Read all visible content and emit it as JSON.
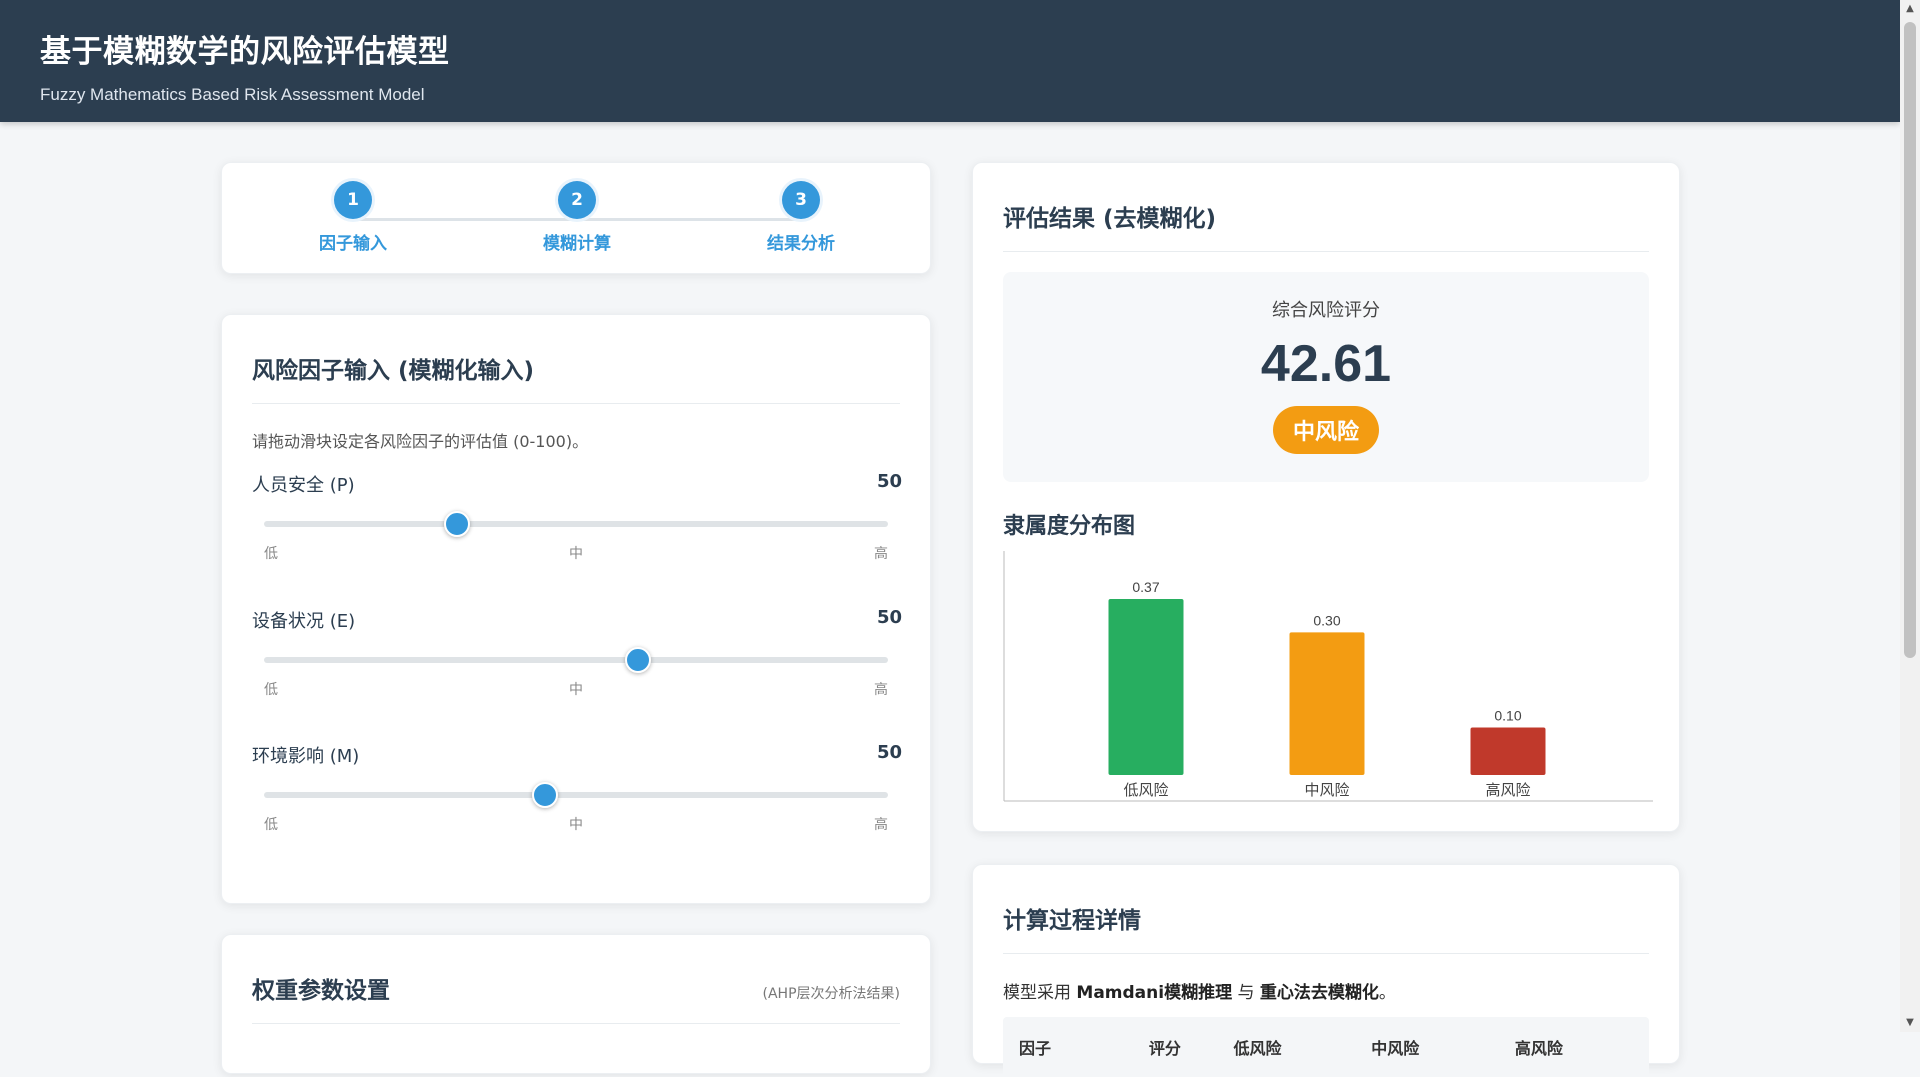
{
  "header": {
    "title": "基于模糊数学的风险评估模型",
    "subtitle": "Fuzzy Mathematics Based Risk Assessment Model"
  },
  "stepper": [
    {
      "num": "1",
      "label": "因子输入"
    },
    {
      "num": "2",
      "label": "模糊计算"
    },
    {
      "num": "3",
      "label": "结果分析"
    }
  ],
  "factors": {
    "title": "风险因子输入 (模糊化输入)",
    "intro": "请拖动滑块设定各风险因子的评估值 (0-100)。",
    "tick_low": "低",
    "tick_mid": "中",
    "tick_high": "高",
    "items": [
      {
        "label": "人员安全 (P)",
        "value": "50",
        "slider_fraction": 0.31
      },
      {
        "label": "设备状况 (E)",
        "value": "50",
        "slider_fraction": 0.6
      },
      {
        "label": "环境影响 (M)",
        "value": "50",
        "slider_fraction": 0.45
      }
    ]
  },
  "weights": {
    "title": "权重参数设置",
    "note": "(AHP层次分析法结果)"
  },
  "result": {
    "title": "评估结果 (去模糊化)",
    "score_label": "综合风险评分",
    "score": "42.61",
    "level": "中风险",
    "level_color": "#f39c12",
    "chart_title": "隶属度分布图"
  },
  "chart_data": {
    "type": "bar",
    "categories": [
      "低风险",
      "中风险",
      "高风险"
    ],
    "values": [
      0.37,
      0.3,
      0.1
    ],
    "value_labels": [
      "0.37",
      "0.30",
      "0.10"
    ],
    "colors": [
      "#27ae60",
      "#f39c12",
      "#c0392b"
    ],
    "ylim": [
      0,
      0.45
    ],
    "grid": false
  },
  "process": {
    "title": "计算过程详情",
    "desc_prefix": "模型采用 ",
    "desc_bold1": "Mamdani模糊推理",
    "desc_mid": " 与 ",
    "desc_bold2": "重心法去模糊化",
    "desc_suffix": "。",
    "table_headers": [
      "因子",
      "评分",
      "低风险",
      "中风险",
      "高风险"
    ]
  },
  "colors": {
    "header_bg": "#2c3e50",
    "accent": "#3498db"
  }
}
